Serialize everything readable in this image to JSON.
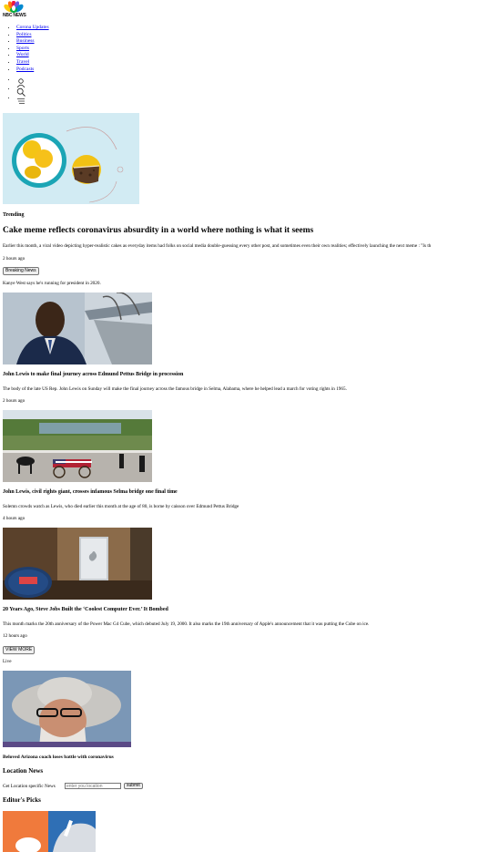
{
  "brand": {
    "wordmark": "NBC NEWS"
  },
  "nav": [
    {
      "label": "Corona Updates"
    },
    {
      "label": "Politics"
    },
    {
      "label": "Business"
    },
    {
      "label": "Sports"
    },
    {
      "label": "World"
    },
    {
      "label": "Travel"
    },
    {
      "label": "Podcasts"
    }
  ],
  "header_icons": [
    "user-icon",
    "search-icon",
    "menu-icon"
  ],
  "trending": {
    "label": "Trending",
    "headline": "Cake meme reflects coronavirus absurdity in a world where nothing is what it seems",
    "summary": "Earlier this month, a viral video depicting hyper-realistic cakes as everyday items had folks on social media double-guessing every other post, and sometimes even their own realities; effectively launching the next meme : \"Is th",
    "time": "2 hours ago"
  },
  "breaking": {
    "button": "Breaking News",
    "text": "Kanye West says he's running for president in 2020."
  },
  "stories": [
    {
      "title": "John Lewis to make final journey across Edmund Pettus Bridge in procession",
      "summary": "The body of the late US Rep. John Lewis on Sunday will make the final journey across the famous bridge in Selma, Alabama, where he helped lead a march for voting rights in 1965.",
      "time": "2 hours ago"
    },
    {
      "title": "John Lewis, civil rights giant, crosses infamous Selma bridge one final time",
      "summary": "Solemn crowds watch as Lewis, who died earlier this month at the age of 80, is borne by caisson over Edmund Pettus Bridge",
      "time": "4 hours ago"
    },
    {
      "title": "20 Years Ago, Steve Jobs Built the ‘Coolest Computer Ever.’ It Bombed",
      "summary": "This month marks the 20th anniversary of the Power Mac G4 Cube, which debuted July 19, 2000. It also marks the 19th anniversary of Apple's announcement that it was putting the Cube on ice.",
      "time": "12 hours ago"
    }
  ],
  "view_more": "VIEW MORE",
  "live": {
    "label": "Live",
    "caption": "Beloved Arizona coach loses battle with coronavirus"
  },
  "location": {
    "heading": "Location News",
    "label": "Get Location specific News",
    "placeholder": "enter you location",
    "submit": "submit"
  },
  "editors_picks": {
    "heading": "Editor's Picks"
  }
}
